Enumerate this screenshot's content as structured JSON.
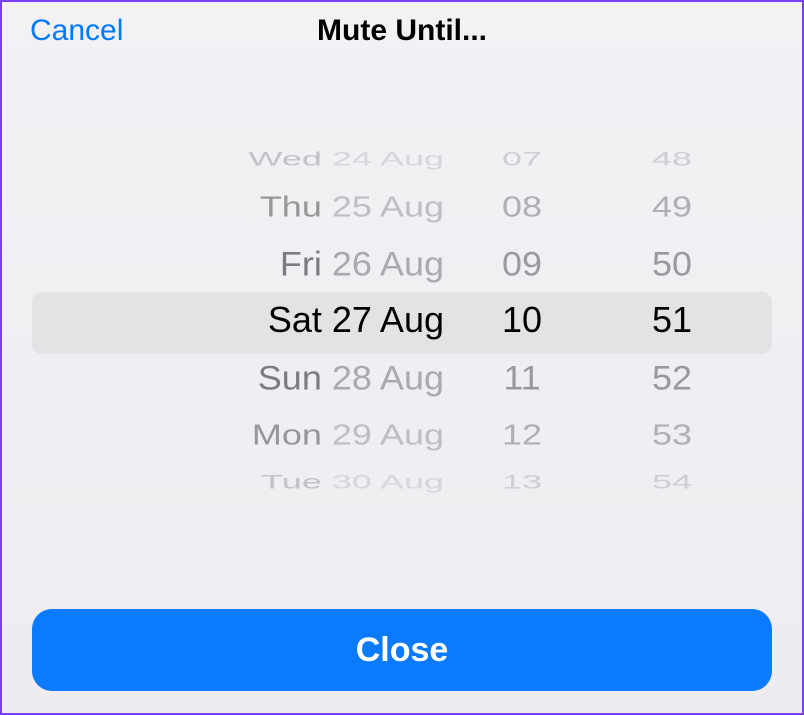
{
  "header": {
    "cancel_label": "Cancel",
    "title": "Mute Until..."
  },
  "picker": {
    "dates": [
      {
        "day": "Wed",
        "date": "24 Aug"
      },
      {
        "day": "Thu",
        "date": "25 Aug"
      },
      {
        "day": "Fri",
        "date": "26 Aug"
      },
      {
        "day": "Sat",
        "date": "27 Aug"
      },
      {
        "day": "Sun",
        "date": "28 Aug"
      },
      {
        "day": "Mon",
        "date": "29 Aug"
      },
      {
        "day": "Tue",
        "date": "30 Aug"
      }
    ],
    "hours": [
      "07",
      "08",
      "09",
      "10",
      "11",
      "12",
      "13"
    ],
    "minutes": [
      "48",
      "49",
      "50",
      "51",
      "52",
      "53",
      "54"
    ],
    "selected_index": 3
  },
  "footer": {
    "close_label": "Close"
  },
  "colors": {
    "accent_blue": "#007aff",
    "button_blue": "#0a7aff",
    "border_purple": "#7b3ff2"
  }
}
